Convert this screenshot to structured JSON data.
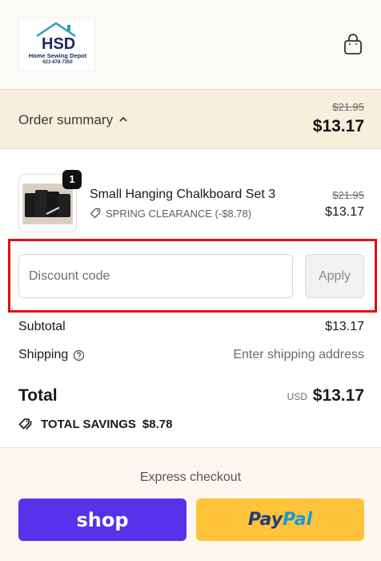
{
  "header": {
    "logo": {
      "mark": "HSD",
      "name": "Home Sewing Depot",
      "phone": "623-878-7350"
    },
    "cart_icon": "shopping-bag-icon"
  },
  "order_summary": {
    "label": "Order summary",
    "chevron_icon": "chevron-up-icon",
    "original_price": "$21.95",
    "price": "$13.17"
  },
  "line_item": {
    "quantity": "1",
    "name": "Small Hanging Chalkboard Set 3",
    "discount_icon": "tag-icon",
    "discount_label": "SPRING CLEARANCE (-$8.78)",
    "original_price": "$21.95",
    "price": "$13.17"
  },
  "discount": {
    "placeholder": "Discount code",
    "value": "",
    "apply_label": "Apply"
  },
  "totals": {
    "subtotal_label": "Subtotal",
    "subtotal_value": "$13.17",
    "shipping_label": "Shipping",
    "shipping_help_icon": "question-circle-icon",
    "shipping_value": "Enter shipping address",
    "total_label": "Total",
    "currency": "USD",
    "total_value": "$13.17",
    "savings_icon": "tags-icon",
    "savings_label": "TOTAL SAVINGS",
    "savings_value": "$8.78"
  },
  "express_checkout": {
    "title": "Express checkout",
    "shop_label": "shop",
    "paypal_part1": "Pay",
    "paypal_part2": "Pal"
  },
  "colors": {
    "highlight": "#e01010",
    "shop_brand": "#5433eb",
    "paypal_brand": "#ffc439",
    "summary_band": "#f5efdc"
  }
}
